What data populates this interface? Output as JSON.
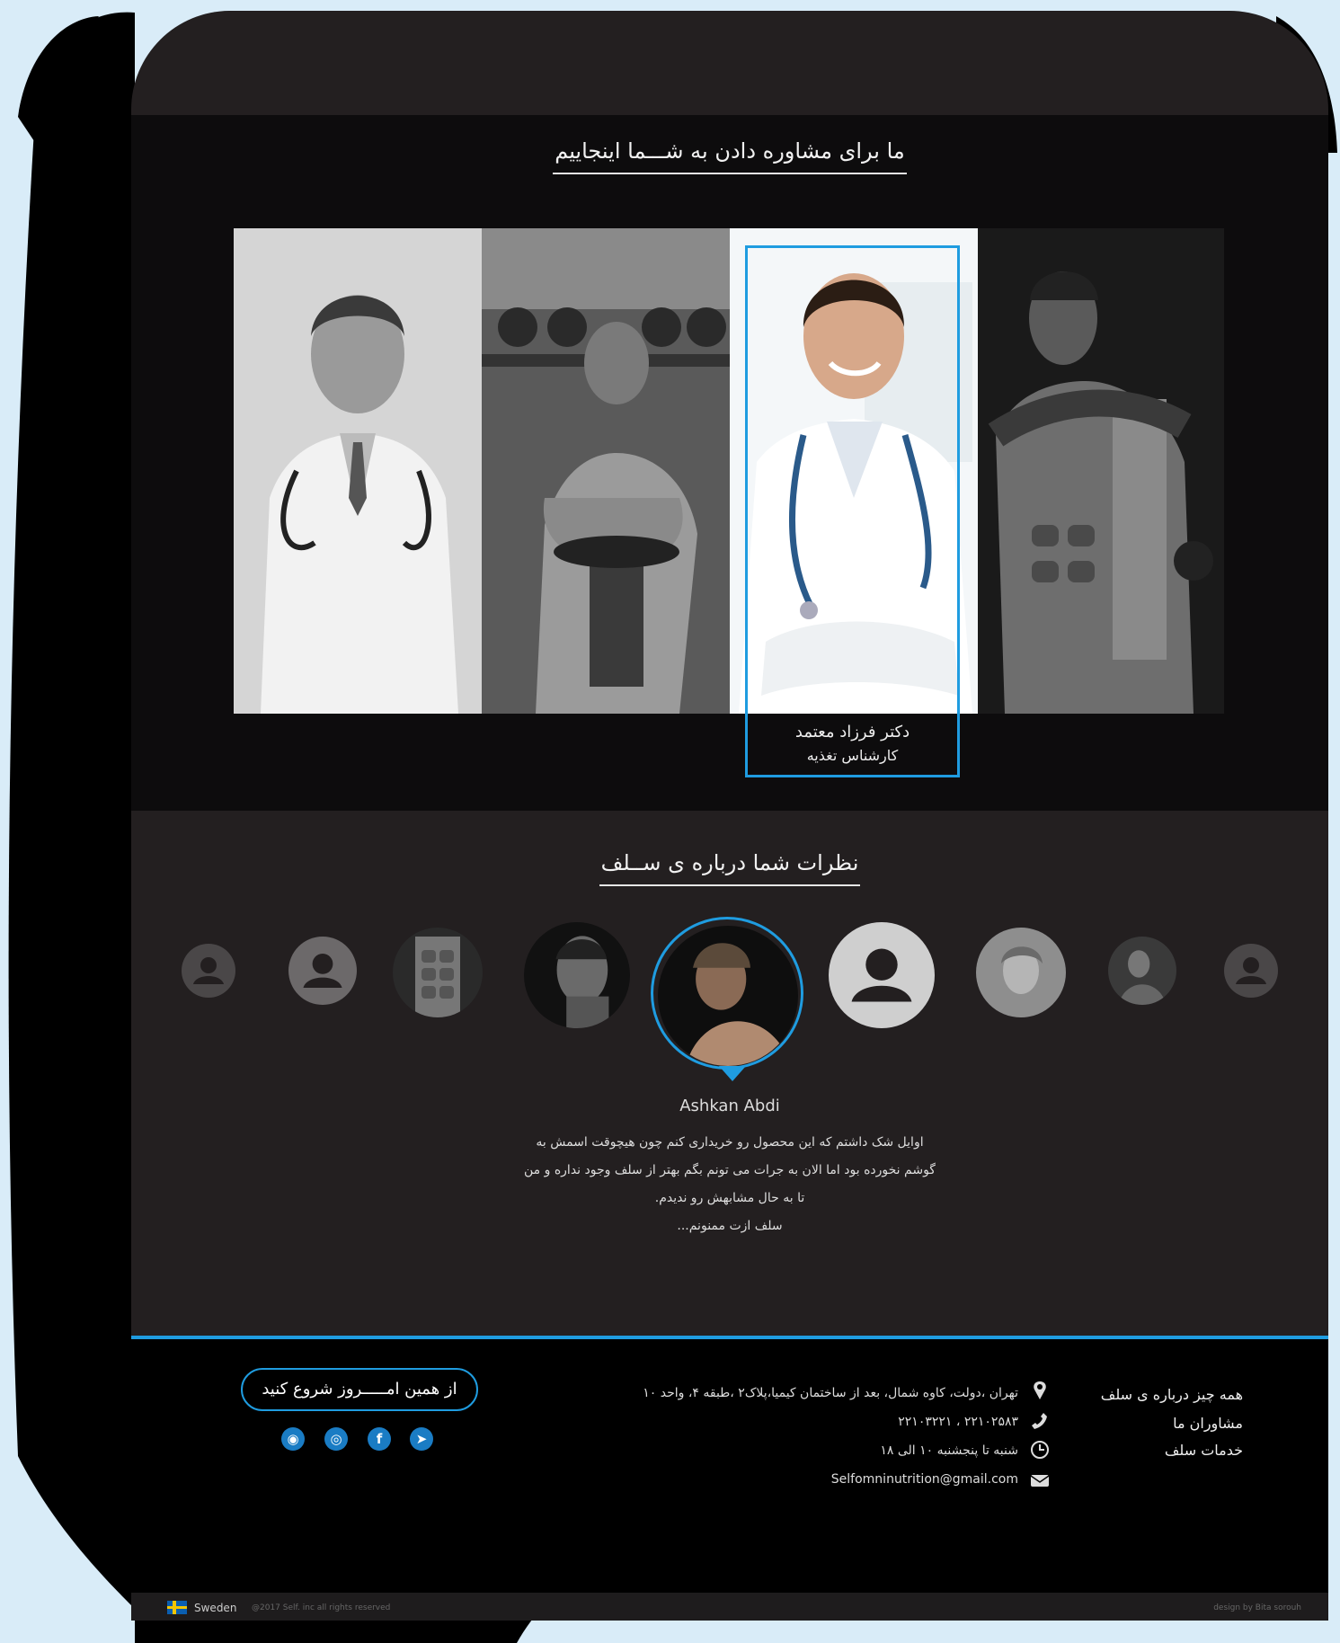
{
  "consultants": {
    "section_title": "ما برای مشاوره دادن به شـــما اینجاییم",
    "featured": {
      "name": "دکتر فرزاد معتمد",
      "role": "کارشناس تغذیه"
    }
  },
  "testimonials": {
    "section_title": "نظرات شما درباره ی ســلف",
    "active_name": "Ashkan Abdi",
    "text_lines": [
      "اوایل شک داشتم که این محصول رو خریداری کنم چون هیچوقت اسمش به",
      "گوشم نخورده بود اما الان به جرات می تونم بگم بهتر از سلف وجود نداره و من",
      "تا به حال مشابهش رو ندیدم.",
      "سلف ازت ممنونم..."
    ]
  },
  "footer": {
    "links": [
      "همه چیز درباره ی سلف",
      "مشاوران ما",
      "خدمات سلف"
    ],
    "address": "تهران ،دولت، کاوه شمال، بعد از ساختمان کیمیا،پلاک۲ ،طبقه ۴، واحد ۱۰",
    "phones": "۲۲۱۰۲۵۸۳ ، ۲۲۱۰۳۲۲۱",
    "hours": "شنبه تا پنجشنبه ۱۰ الی ۱۸",
    "email": "Selfomninutrition@gmail.com",
    "cta_label": "از همین امـــــروز شروع کنید",
    "social_icons": [
      "rss-icon",
      "instagram-icon",
      "facebook-icon",
      "telegram-icon"
    ],
    "country": "Sweden",
    "copyright": "@2017 Self. inc all rights reserved",
    "designer": "design by Bita sorouh"
  },
  "colors": {
    "accent": "#1f9ce0",
    "page_bg": "#0d0c0d",
    "section_bg": "#231f20",
    "backdrop": "#d9ecf8"
  }
}
